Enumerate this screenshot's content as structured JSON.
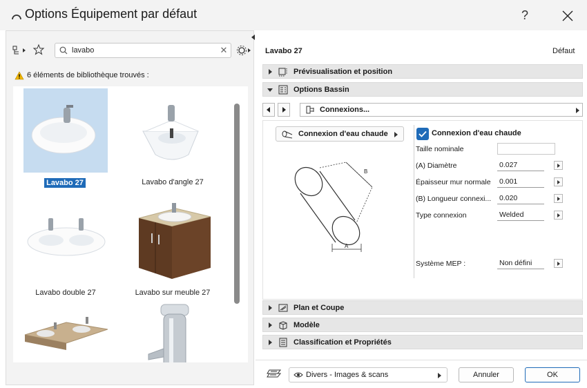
{
  "window": {
    "title": "Options Équipement par défaut",
    "help": "?",
    "close": "✕"
  },
  "left": {
    "search": {
      "value": "lavabo",
      "clear": "✕"
    },
    "found_text": "6 éléments de bibliothèque trouvés :",
    "items": [
      {
        "label": "Lavabo 27",
        "selected": true
      },
      {
        "label": "Lavabo d'angle 27",
        "selected": false
      },
      {
        "label": "Lavabo double 27",
        "selected": false
      },
      {
        "label": "Lavabo sur meuble 27",
        "selected": false
      },
      {
        "label": "",
        "selected": false
      },
      {
        "label": "",
        "selected": false
      }
    ]
  },
  "right": {
    "object_name": "Lavabo 27",
    "defaut_label": "Défaut",
    "sections_top": [
      {
        "label": "Prévisualisation et position",
        "open": false
      },
      {
        "label": "Options Bassin",
        "open": true
      }
    ],
    "page_selector": "Connexions...",
    "connection_button": "Connexion d'eau chaude",
    "diagram": {
      "label_b": "B",
      "label_a": "A"
    },
    "checkbox_label": "Connexion d'eau chaude",
    "params": [
      {
        "label": "Taille nominale",
        "value": ""
      },
      {
        "label": "(A) Diamètre",
        "value": "0.027"
      },
      {
        "label": "Épaisseur mur normale",
        "value": "0.001"
      },
      {
        "label": "(B) Longueur connexi...",
        "value": "0.020"
      },
      {
        "label": "Type connexion",
        "value": "Welded"
      },
      {
        "label": "Système MEP :",
        "value": "Non défini"
      }
    ],
    "sections_bottom": [
      {
        "label": "Plan et Coupe"
      },
      {
        "label": "Modèle"
      },
      {
        "label": "Classification et Propriétés"
      }
    ],
    "layer": "Divers - Images & scans",
    "cancel": "Annuler",
    "ok": "OK"
  },
  "colors": {
    "accent": "#1f6bb8",
    "selection": "#c6dcf0",
    "section_bg": "#e6e6e6"
  }
}
